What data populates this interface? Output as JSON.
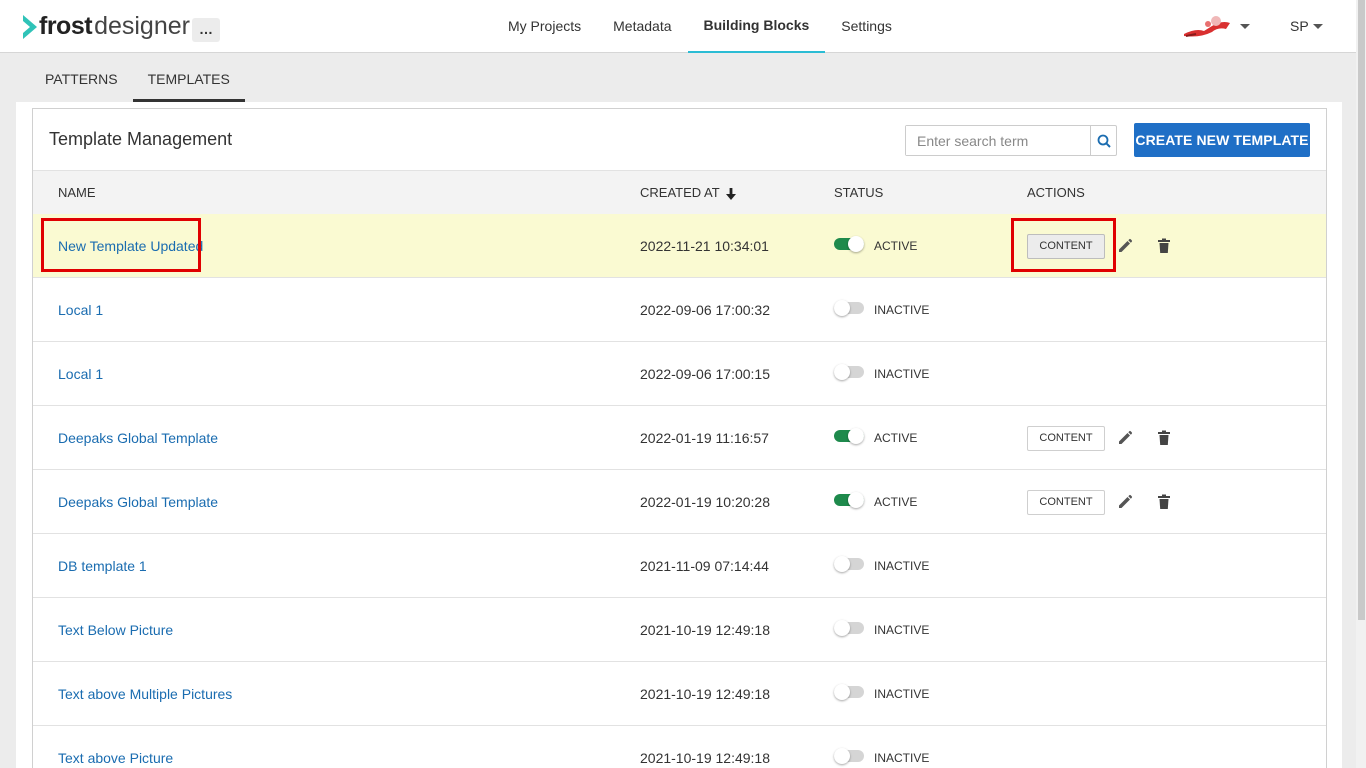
{
  "app": {
    "brand_bold": "frost",
    "brand_light": "designer",
    "more_label": "…"
  },
  "nav": [
    "My Projects",
    "Metadata",
    "Building Blocks",
    "Settings"
  ],
  "nav_active": "Building Blocks",
  "user": {
    "initials": "SP"
  },
  "subtabs": [
    "PATTERNS",
    "TEMPLATES"
  ],
  "subtab_active": "TEMPLATES",
  "panel": {
    "title": "Template Management",
    "search_placeholder": "Enter search term",
    "create_label": "CREATE NEW TEMPLATE"
  },
  "columns": {
    "name": "NAME",
    "created_at": "CREATED AT",
    "status": "STATUS",
    "actions": "ACTIONS"
  },
  "content_label": "CONTENT",
  "rows": [
    {
      "name": "New Template Updated",
      "created_at": "2022-11-21 10:34:01",
      "status": "ACTIVE",
      "active": true
    },
    {
      "name": "Local 1",
      "created_at": "2022-09-06 17:00:32",
      "status": "INACTIVE",
      "active": false
    },
    {
      "name": "Local 1",
      "created_at": "2022-09-06 17:00:15",
      "status": "INACTIVE",
      "active": false
    },
    {
      "name": "Deepaks Global Template",
      "created_at": "2022-01-19 11:16:57",
      "status": "ACTIVE",
      "active": true
    },
    {
      "name": "Deepaks Global Template",
      "created_at": "2022-01-19 10:20:28",
      "status": "ACTIVE",
      "active": true
    },
    {
      "name": "DB template 1",
      "created_at": "2021-11-09 07:14:44",
      "status": "INACTIVE",
      "active": false
    },
    {
      "name": "Text Below Picture",
      "created_at": "2021-10-19 12:49:18",
      "status": "INACTIVE",
      "active": false
    },
    {
      "name": "Text above Multiple Pictures",
      "created_at": "2021-10-19 12:49:18",
      "status": "INACTIVE",
      "active": false
    },
    {
      "name": "Text above Picture",
      "created_at": "2021-10-19 12:49:18",
      "status": "INACTIVE",
      "active": false
    }
  ],
  "colors": {
    "accent": "#1f6fc6",
    "link": "#1a6cb0",
    "toggle_on": "#1e8a4c",
    "highlight_row": "#fafad2",
    "annotation": "#e00000"
  }
}
